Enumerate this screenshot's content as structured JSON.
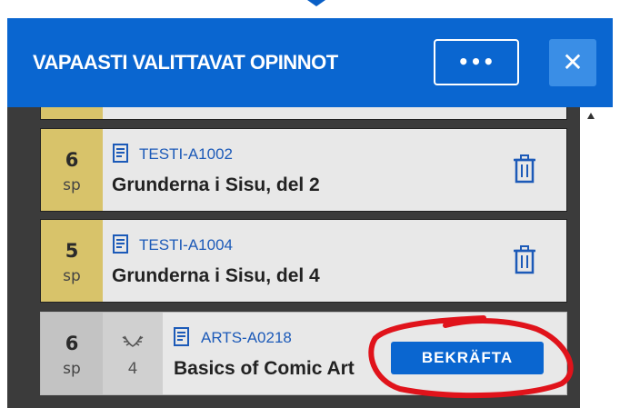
{
  "header": {
    "title": "VAPAASTI VALITTAVAT OPINNOT",
    "more_label": "•••",
    "close_label": "✕"
  },
  "courses": [
    {
      "credits": "6",
      "unit": "sp",
      "code": "TESTI-A1002",
      "name": "Grunderna i Sisu, del 2"
    },
    {
      "credits": "5",
      "unit": "sp",
      "code": "TESTI-A1004",
      "name": "Grunderna i Sisu, del 4"
    },
    {
      "credits": "6",
      "unit": "sp",
      "grade": "4",
      "code": "ARTS-A0218",
      "name": "Basics of Comic Art",
      "confirm_label": "BEKRÄFTA"
    }
  ],
  "colors": {
    "header": "#0a66d0",
    "credits_accent": "#d8c36a",
    "pending_credits": "#c3c3c3",
    "annotation": "#e0131b"
  },
  "icons": [
    "document-icon",
    "trash-icon",
    "laurel-icon",
    "close-icon",
    "more-icon",
    "scroll-up-icon"
  ]
}
